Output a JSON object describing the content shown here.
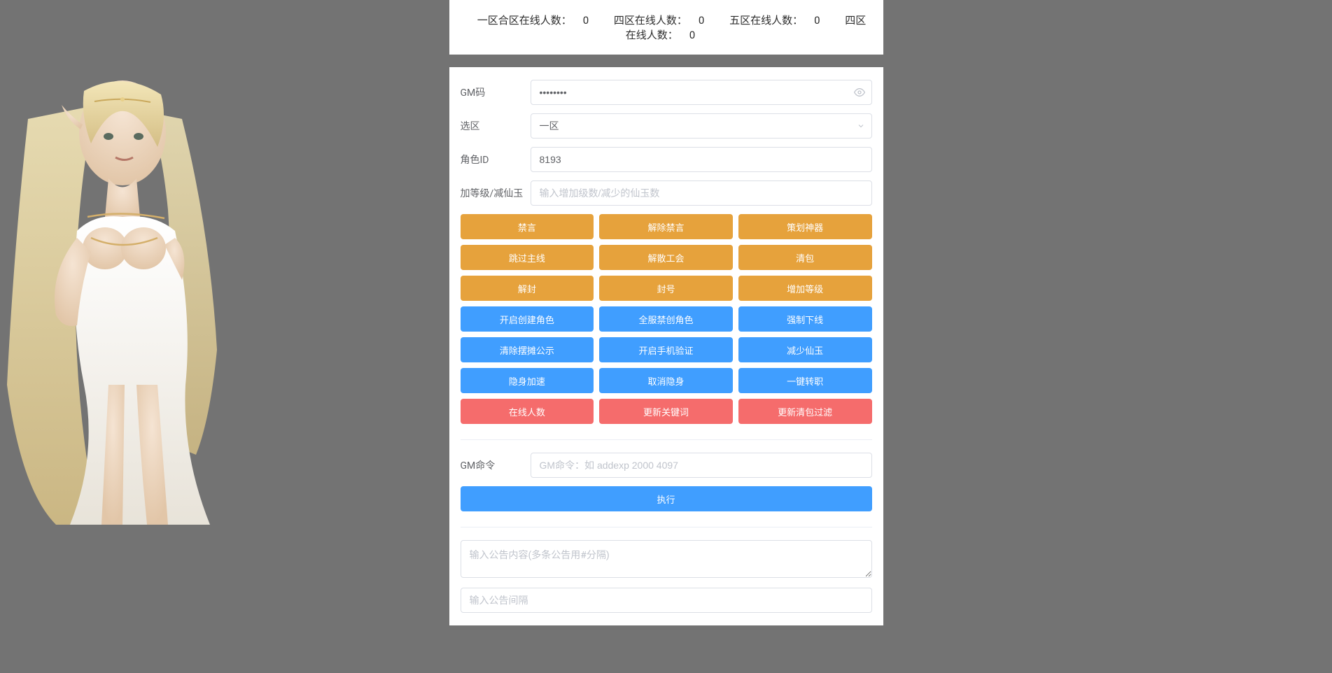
{
  "header": {
    "stats": [
      {
        "label": "一区合区在线人数：",
        "value": "0"
      },
      {
        "label": "四区在线人数：",
        "value": "0"
      },
      {
        "label": "五区在线人数：",
        "value": "0"
      },
      {
        "label": "四区在线人数：",
        "value": "0"
      }
    ]
  },
  "form": {
    "gm_code_label": "GM码",
    "gm_code_value": "••••••••",
    "zone_label": "选区",
    "zone_value": "一区",
    "role_id_label": "角色ID",
    "role_id_value": "8193",
    "level_label": "加等级/减仙玉",
    "level_placeholder": "输入增加级数/减少的仙玉数"
  },
  "buttons": {
    "orange": [
      [
        "禁言",
        "解除禁言",
        "策划神器"
      ],
      [
        "跳过主线",
        "解散工会",
        "清包"
      ],
      [
        "解封",
        "封号",
        "增加等级"
      ]
    ],
    "blue": [
      [
        "开启创建角色",
        "全服禁创角色",
        "强制下线"
      ],
      [
        "清除摆摊公示",
        "开启手机验证",
        "减少仙玉"
      ],
      [
        "隐身加速",
        "取消隐身",
        "一键转职"
      ]
    ],
    "red": [
      [
        "在线人数",
        "更新关键词",
        "更新清包过滤"
      ]
    ]
  },
  "cmd": {
    "label": "GM命令",
    "placeholder": "GM命令：如 addexp 2000 4097",
    "execute": "执行"
  },
  "notice": {
    "content_placeholder": "输入公告内容(多条公告用#分隔)",
    "interval_placeholder": "输入公告间隔"
  }
}
